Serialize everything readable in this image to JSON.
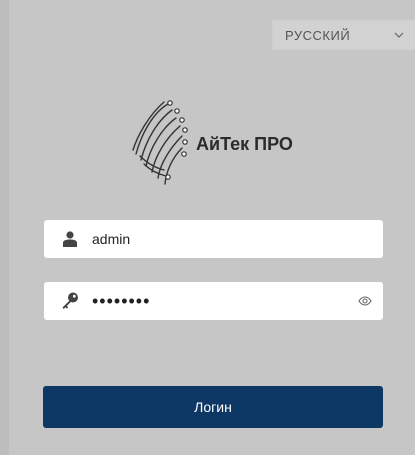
{
  "language": {
    "selected": "РУССКИЙ",
    "icon": "chevron-down-icon"
  },
  "brand": {
    "name": "АйТек ПРО",
    "icon": "circuit-leaf-logo"
  },
  "form": {
    "username": {
      "value": "admin",
      "icon": "user-icon"
    },
    "password": {
      "value": "••••••••",
      "icon": "key-icon",
      "toggle_icon": "eye-icon"
    },
    "login_label": "Логин"
  },
  "colors": {
    "background": "#c6c6c6",
    "button": "#0d3764",
    "field": "#ffffff"
  }
}
